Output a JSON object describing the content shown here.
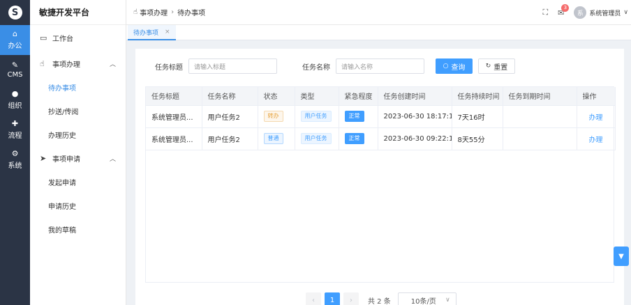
{
  "rail": {
    "items": [
      {
        "label": "办公",
        "icon": "home-icon",
        "glyph": "⌂",
        "active": true
      },
      {
        "label": "CMS",
        "icon": "cms-icon",
        "glyph": "✎"
      },
      {
        "label": "组织",
        "icon": "user-icon",
        "glyph": "●"
      },
      {
        "label": "流程",
        "icon": "flow-icon",
        "glyph": "✚"
      },
      {
        "label": "系统",
        "icon": "gear-icon",
        "glyph": "⚙"
      }
    ],
    "logo_glyph": "S"
  },
  "brand": {
    "title": "敏捷开发平台"
  },
  "sidebar": {
    "workbench": "工作台",
    "group1": {
      "label": "事项办理",
      "items": [
        "待办事项",
        "抄送/传阅",
        "办理历史"
      ]
    },
    "group2": {
      "label": "事项申请",
      "items": [
        "发起申请",
        "申请历史",
        "我的草稿"
      ]
    }
  },
  "header": {
    "breadcrumb": [
      "事项办理",
      "待办事项"
    ],
    "badge": "3",
    "avatar_text": "系",
    "user": "系统管理员"
  },
  "tabs": [
    {
      "label": "待办事项",
      "close": "×"
    }
  ],
  "search": {
    "title_label": "任务标题",
    "title_placeholder": "请输入标题",
    "name_label": "任务名称",
    "name_placeholder": "请输入名称",
    "query": "查询",
    "reset": "重置"
  },
  "table": {
    "columns": [
      "任务标题",
      "任务名称",
      "状态",
      "类型",
      "紧急程度",
      "任务创建时间",
      "任务持续时间",
      "任务到期时间",
      "操作"
    ],
    "rows": [
      {
        "title": "系统管理员...",
        "name": "用户任务2",
        "status": "转办",
        "type": "用户任务",
        "urgency": "正常",
        "created": "2023-06-30 18:17:16",
        "duration": "7天16时",
        "due": "",
        "action": "办理"
      },
      {
        "title": "系统管理员...",
        "name": "用户任务2",
        "status": "普通",
        "type": "用户任务",
        "urgency": "正常",
        "created": "2023-06-30 09:22:19",
        "duration": "8天55分",
        "due": "",
        "action": "办理"
      }
    ]
  },
  "pagination": {
    "prev": "‹",
    "page": "1",
    "next": "›",
    "total": "共 2 条",
    "size": "10条/页"
  },
  "colors": {
    "accent": "#409eff",
    "rail": "#2b3445",
    "warn": "#e6a23c"
  }
}
